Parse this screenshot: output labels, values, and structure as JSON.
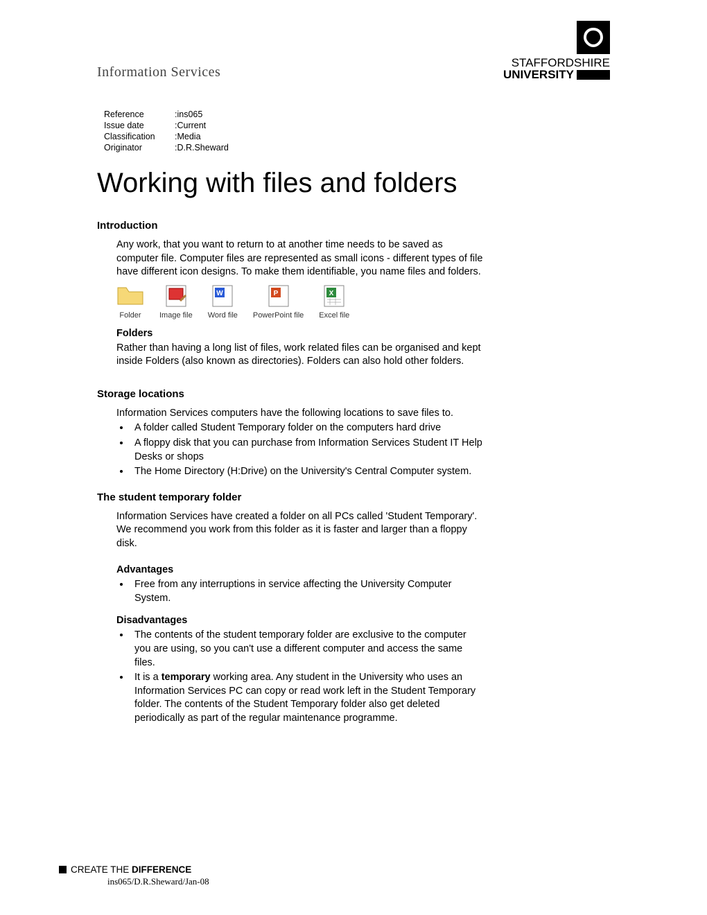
{
  "header": {
    "department": "Information Services",
    "logo": {
      "line1": "STAFFORDSHIRE",
      "line2": "UNIVERSITY"
    }
  },
  "meta": {
    "rows": [
      {
        "label": "Reference",
        "value": ":ins065"
      },
      {
        "label": "Issue date",
        "value": ":Current"
      },
      {
        "label": "Classification",
        "value": ":Media"
      },
      {
        "label": "Originator",
        "value": ":D.R.Sheward"
      }
    ]
  },
  "title": "Working with files and folders",
  "intro": {
    "heading": "Introduction",
    "para": "Any work, that you want to return to at another time needs to be saved as computer file. Computer files are represented as small icons - different types of file have different icon designs. To make them identifiable, you name files and folders.",
    "icons": [
      {
        "key": "folder-icon",
        "label": "Folder"
      },
      {
        "key": "image-file-icon",
        "label": "Image file"
      },
      {
        "key": "word-file-icon",
        "label": "Word file"
      },
      {
        "key": "powerpoint-file-icon",
        "label": "PowerPoint file"
      },
      {
        "key": "excel-file-icon",
        "label": "Excel file"
      }
    ],
    "folders_heading": "Folders",
    "folders_para": "Rather than having a long list of files, work related files can be organised and kept inside Folders (also known as directories). Folders can also hold other folders."
  },
  "storage": {
    "heading": "Storage locations",
    "para": "Information Services computers have the following locations to save files to.",
    "items": [
      "A folder called Student Temporary folder on the computers hard drive",
      "A floppy disk that you can purchase from Information Services Student IT Help Desks or shops",
      "The Home Directory (H:Drive) on the University's Central Computer system."
    ]
  },
  "temp": {
    "heading": "The student temporary folder",
    "para1": "Information Services have created a folder on all PCs called 'Student Temporary'.",
    "para2": "We recommend you work from this folder as it is faster and larger than a floppy disk.",
    "adv_heading": "Advantages",
    "adv_items": [
      "Free from any interruptions in service affecting the University Computer System."
    ],
    "dis_heading": "Disadvantages",
    "dis_items": [
      "The contents of the student temporary folder are exclusive to the computer you are using, so you can't use a different computer and access the same files."
    ],
    "dis_item2_pre": "It is a ",
    "dis_item2_bold": "temporary",
    "dis_item2_post": " working area. Any student in the University who uses an Information  Services PC can copy or read work left in the Student Temporary folder. The contents of the Student Temporary folder also get deleted periodically as part of the regular maintenance programme."
  },
  "footer": {
    "line1_normal": "CREATE THE ",
    "line1_bold": "DIFFERENCE",
    "line2": "ins065/D.R.Sheward/Jan-08"
  }
}
